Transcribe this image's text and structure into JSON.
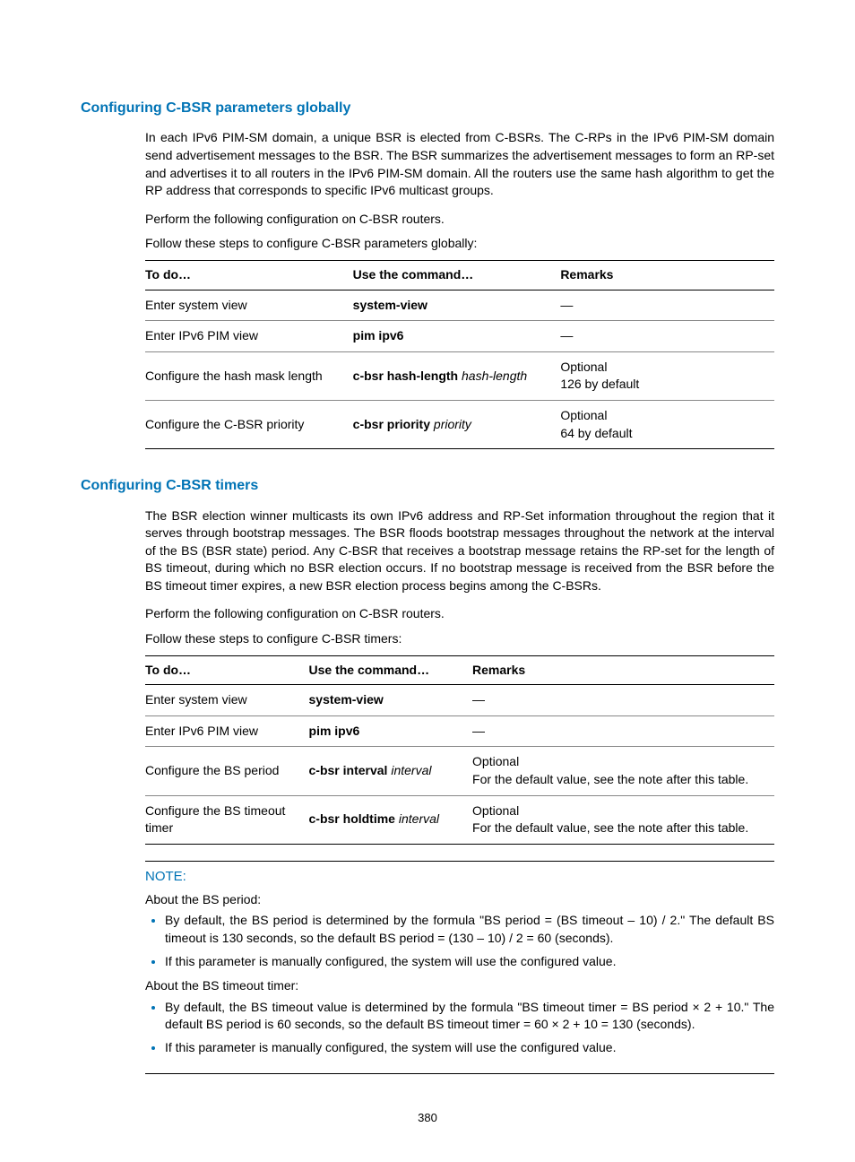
{
  "section1": {
    "heading": "Configuring C-BSR parameters globally",
    "para1": "In each IPv6 PIM-SM domain, a unique BSR is elected from C-BSRs. The C-RPs in the IPv6 PIM-SM domain send advertisement messages to the BSR. The BSR summarizes the advertisement messages to form an RP-set and advertises it to all routers in the IPv6 PIM-SM domain. All the routers use the same hash algorithm to get the RP address that corresponds to specific IPv6 multicast groups.",
    "para2": "Perform the following configuration on C-BSR routers.",
    "para3": "Follow these steps to configure C-BSR parameters globally:",
    "table": {
      "h1": "To do…",
      "h2": "Use the command…",
      "h3": "Remarks",
      "r1c1": "Enter system view",
      "r1c2": "system-view",
      "r1c3": "—",
      "r2c1": "Enter IPv6 PIM view",
      "r2c2": "pim ipv6",
      "r2c3": "—",
      "r3c1": "Configure the hash mask length",
      "r3c2a": "c-bsr hash-length",
      "r3c2b": "hash-length",
      "r3c3a": "Optional",
      "r3c3b": "126 by default",
      "r4c1": "Configure the C-BSR priority",
      "r4c2a": "c-bsr priority",
      "r4c2b": "priority",
      "r4c3a": "Optional",
      "r4c3b": "64 by default"
    }
  },
  "section2": {
    "heading": "Configuring C-BSR timers",
    "para1": "The BSR election winner multicasts its own IPv6 address and RP-Set information throughout the region that it serves through bootstrap messages. The BSR floods bootstrap messages throughout the network at the interval of the BS (BSR state) period. Any C-BSR that receives a bootstrap message retains the RP-set for the length of BS timeout, during which no BSR election occurs. If no bootstrap message is received from the BSR before the BS timeout timer expires, a new BSR election process begins among the C-BSRs.",
    "para2": "Perform the following configuration on C-BSR routers.",
    "para3": "Follow these steps to configure C-BSR timers:",
    "table": {
      "h1": "To do…",
      "h2": "Use the command…",
      "h3": "Remarks",
      "r1c1": "Enter system view",
      "r1c2": "system-view",
      "r1c3": "—",
      "r2c1": "Enter IPv6 PIM view",
      "r2c2": "pim ipv6",
      "r2c3": "—",
      "r3c1": "Configure the BS period",
      "r3c2a": "c-bsr interval",
      "r3c2b": "interval",
      "r3c3a": "Optional",
      "r3c3b": "For the default value, see the note after this table.",
      "r4c1": "Configure the BS timeout timer",
      "r4c2a": "c-bsr holdtime",
      "r4c2b": "interval",
      "r4c3a": "Optional",
      "r4c3b": "For the default value, see the note after this table."
    }
  },
  "note": {
    "heading": "NOTE:",
    "sub1": "About the BS period:",
    "li1": "By default, the BS period is determined by the formula \"BS period = (BS timeout – 10) / 2.\" The default BS timeout is 130 seconds, so the default BS period = (130 – 10) / 2 = 60 (seconds).",
    "li2": "If this parameter is manually configured, the system will use the configured value.",
    "sub2": "About the BS timeout timer:",
    "li3": "By default, the BS timeout value is determined by the formula \"BS timeout timer = BS period × 2 + 10.\" The default BS period is 60 seconds, so the default BS timeout timer = 60 × 2 + 10 = 130 (seconds).",
    "li4": "If this parameter is manually configured, the system will use the configured value."
  },
  "pageNumber": "380"
}
